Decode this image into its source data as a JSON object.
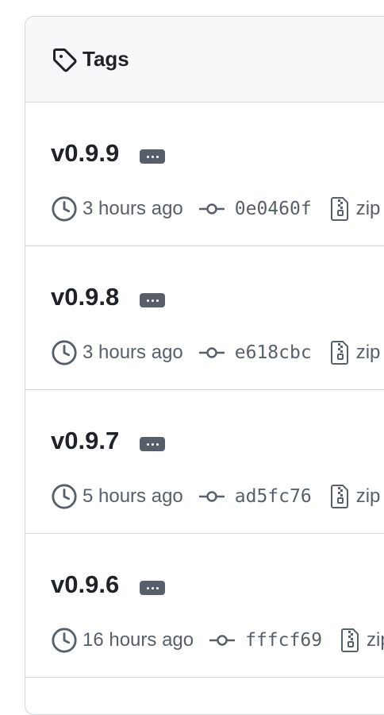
{
  "header": {
    "title": "Tags",
    "icon": "tag-icon"
  },
  "tags": [
    {
      "name": "v0.9.9",
      "time": "3 hours ago",
      "sha": "0e0460f",
      "zip": "zip"
    },
    {
      "name": "v0.9.8",
      "time": "3 hours ago",
      "sha": "e618cbc",
      "zip": "zip"
    },
    {
      "name": "v0.9.7",
      "time": "5 hours ago",
      "sha": "ad5fc76",
      "zip": "zip"
    },
    {
      "name": "v0.9.6",
      "time": "16 hours ago",
      "sha": "fffcf69",
      "zip": "zip"
    }
  ],
  "colors": {
    "border": "#d0d7de",
    "header_bg": "#f6f8fa",
    "text": "#1f2328",
    "muted": "#57606a"
  }
}
